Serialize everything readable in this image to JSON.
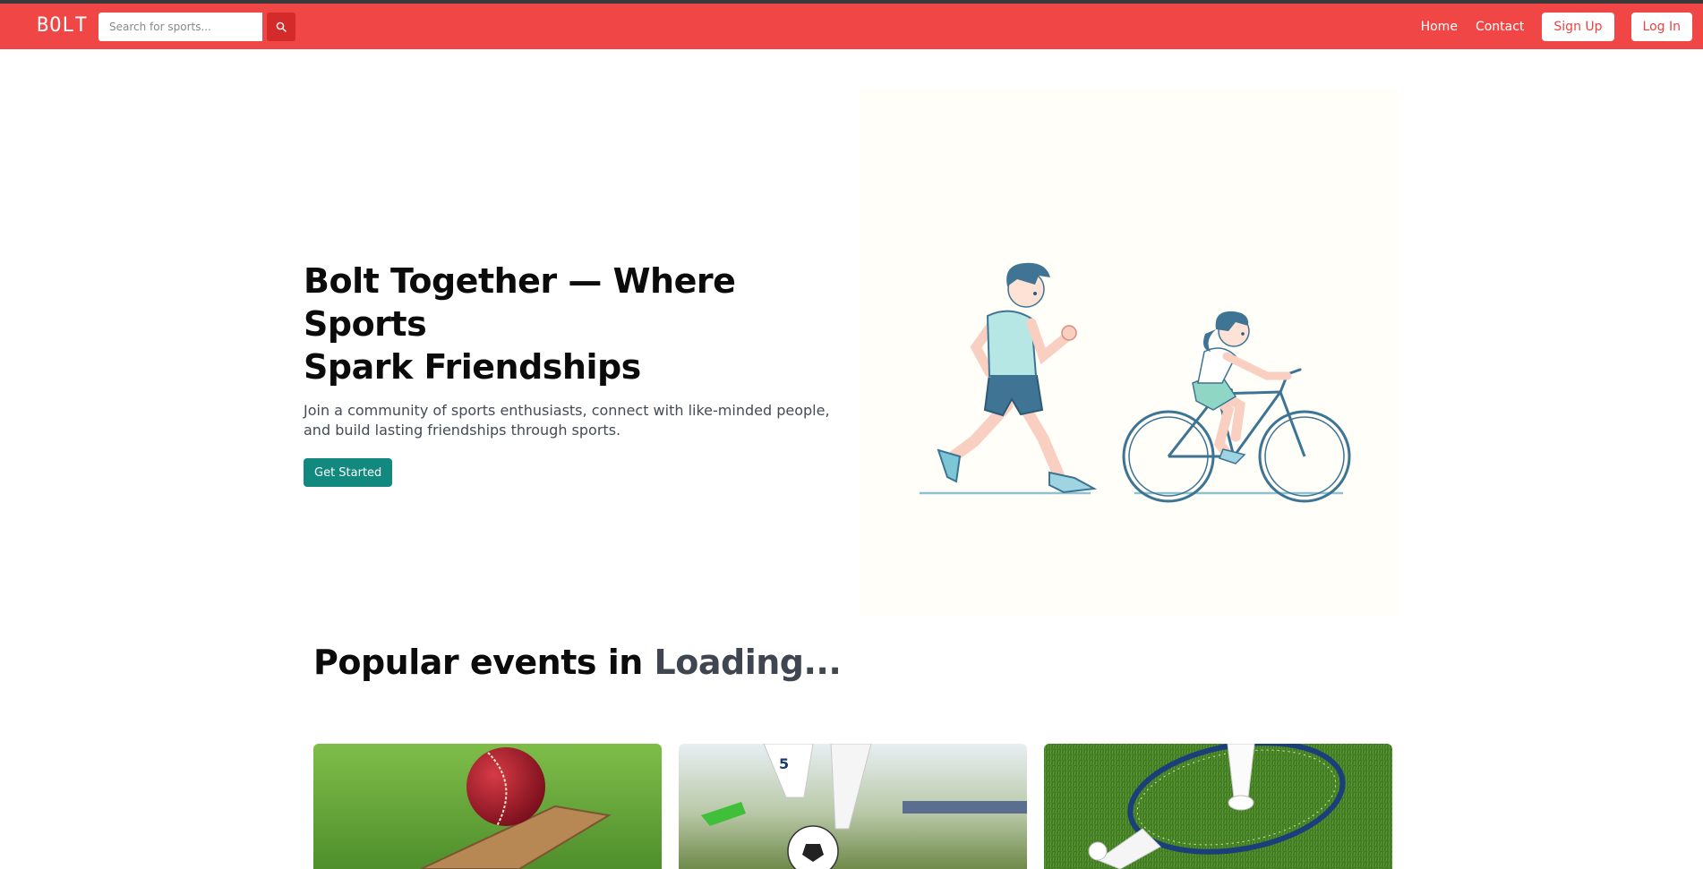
{
  "navbar": {
    "logo": "BOLT",
    "search_placeholder": "Search for sports...",
    "links": {
      "home": "Home",
      "contact": "Contact"
    },
    "signup_label": "Sign Up",
    "login_label": "Log In"
  },
  "hero": {
    "title_line1": "Bolt Together — Where Sports",
    "title_line2": "Spark Friendships",
    "subtitle_line1": "Join a community of sports enthusiasts, connect with like-minded people,",
    "subtitle_line2": "and build lasting friendships through sports.",
    "cta_label": "Get Started"
  },
  "events": {
    "heading_prefix": "Popular events in",
    "heading_location": "Loading...",
    "cards": [
      {
        "sport": "cricket"
      },
      {
        "sport": "football",
        "jersey_number": "5"
      },
      {
        "sport": "badminton"
      }
    ]
  },
  "colors": {
    "brand": "#f04646",
    "search_button": "#d42a2a",
    "cta": "#12897f",
    "heading_accent": "#3f4650"
  }
}
